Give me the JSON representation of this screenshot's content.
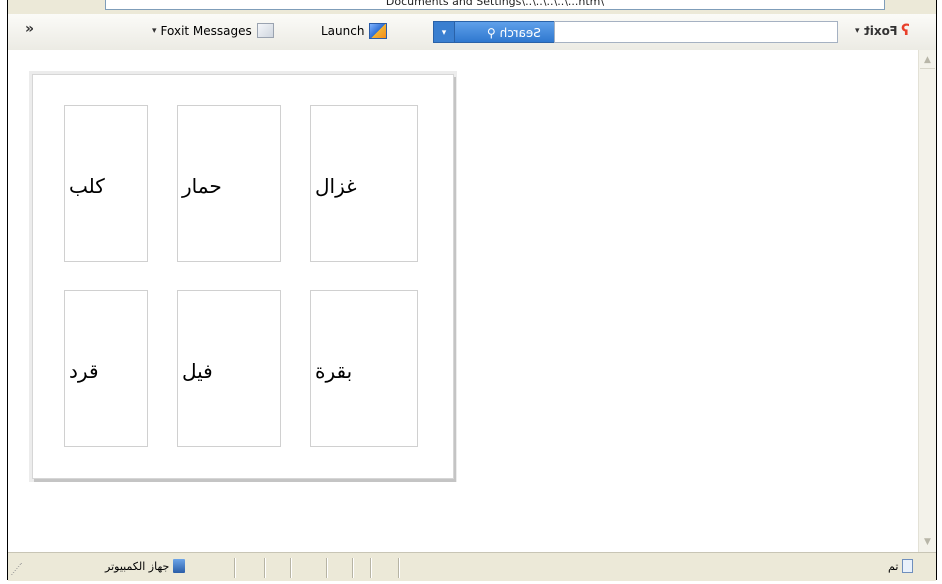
{
  "address_bar": {
    "url_fragment": "\\Documents and Settings\\..\\..\\..\\..\\...htm"
  },
  "toolbar": {
    "collapse_glyph": "»",
    "dropdown_glyph": "▾",
    "messages_label": "Foxit Messages",
    "launch_label": "Launch",
    "search_label": "Search",
    "search_input_value": "",
    "brand_label": "Foxit"
  },
  "cards": [
    {
      "word": "كلب"
    },
    {
      "word": "حمار"
    },
    {
      "word": "غزال"
    },
    {
      "word": "قرد"
    },
    {
      "word": "فيل"
    },
    {
      "word": "بقرة"
    }
  ],
  "statusbar": {
    "zone_label": "جهاز الكمبيوتر",
    "done_label": "تم"
  },
  "icons": {
    "messages": "messages-icon",
    "launch": "launch-icon",
    "search": "magnifier-icon",
    "brand": "foxit-logo-icon",
    "computer": "computer-icon",
    "page": "page-icon"
  }
}
